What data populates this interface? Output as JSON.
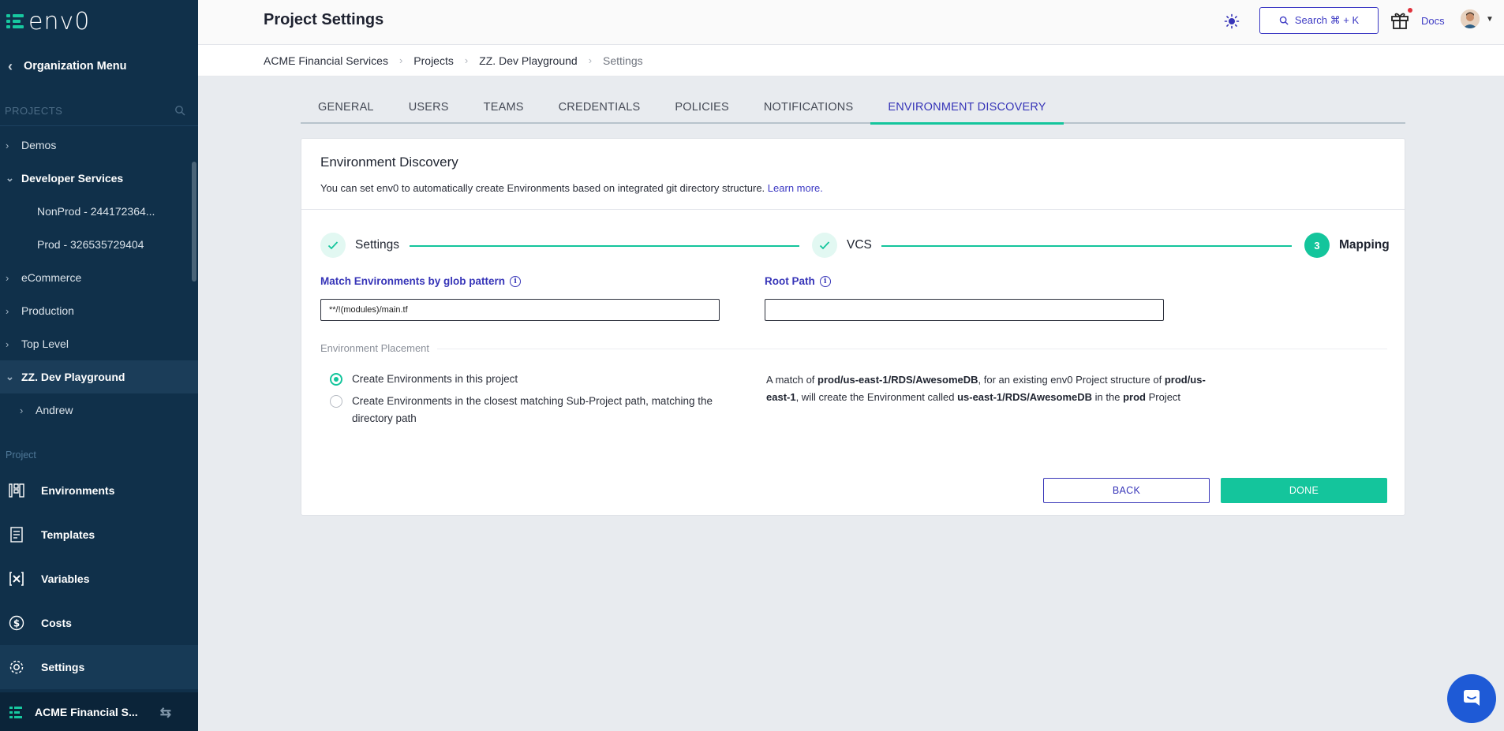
{
  "app": {
    "logo_text": "env0"
  },
  "sidebar": {
    "org_menu_label": "Organization Menu",
    "projects_heading": "PROJECTS",
    "tree": [
      {
        "label": "Demos",
        "expanded": false
      },
      {
        "label": "Developer Services",
        "expanded": true
      },
      {
        "label": "NonProd - 244172364..."
      },
      {
        "label": "Prod - 326535729404"
      },
      {
        "label": "eCommerce",
        "expanded": false
      },
      {
        "label": "Production",
        "expanded": false
      },
      {
        "label": "Top Level",
        "expanded": false
      },
      {
        "label": "ZZ. Dev Playground",
        "expanded": true,
        "active": true
      },
      {
        "label": "Andrew",
        "expanded": false
      }
    ],
    "project_section_label": "Project",
    "nav": [
      {
        "label": "Environments",
        "icon": "environments-icon"
      },
      {
        "label": "Templates",
        "icon": "templates-icon"
      },
      {
        "label": "Variables",
        "icon": "variables-icon"
      },
      {
        "label": "Costs",
        "icon": "costs-icon"
      },
      {
        "label": "Settings",
        "icon": "settings-icon",
        "active": true
      }
    ],
    "org_footer_label": "ACME Financial S..."
  },
  "header": {
    "title": "Project Settings",
    "search_label": "Search ⌘ + K",
    "docs_label": "Docs"
  },
  "breadcrumb": [
    "ACME Financial Services",
    "Projects",
    "ZZ. Dev Playground",
    "Settings"
  ],
  "tabs": [
    {
      "label": "GENERAL"
    },
    {
      "label": "USERS"
    },
    {
      "label": "TEAMS"
    },
    {
      "label": "CREDENTIALS"
    },
    {
      "label": "POLICIES"
    },
    {
      "label": "NOTIFICATIONS"
    },
    {
      "label": "ENVIRONMENT DISCOVERY",
      "active": true
    }
  ],
  "discovery": {
    "title": "Environment Discovery",
    "description": "You can set env0 to automatically create Environments based on integrated git directory structure.",
    "learn_more": "Learn more.",
    "steps": [
      {
        "label": "Settings",
        "state": "done"
      },
      {
        "label": "VCS",
        "state": "done"
      },
      {
        "label": "Mapping",
        "state": "current",
        "number": "3"
      }
    ],
    "glob_label": "Match Environments by glob pattern",
    "glob_value": "**/!(modules)/main.tf",
    "root_path_label": "Root Path",
    "root_path_value": "",
    "placement_label": "Environment Placement",
    "option_1": "Create Environments in this project",
    "option_2": "Create Environments in the closest matching Sub-Project path, matching the directory path",
    "selected_option": 1,
    "example": {
      "t1": "A match of ",
      "b1": "prod/us-east-1/RDS/AwesomeDB",
      "t2": ", for an existing env0 Project structure of ",
      "b2": "prod/us-east-1",
      "t3": ", will create the Environment called ",
      "b3": "us-east-1/RDS/AwesomeDB",
      "t4": " in the ",
      "b4": "prod",
      "t5": " Project"
    },
    "back_label": "BACK",
    "done_label": "DONE"
  },
  "colors": {
    "sidebar_bg": "#10304a",
    "accent_teal": "#14c59c",
    "accent_indigo": "#3735b8",
    "page_bg": "#e8ebef"
  }
}
